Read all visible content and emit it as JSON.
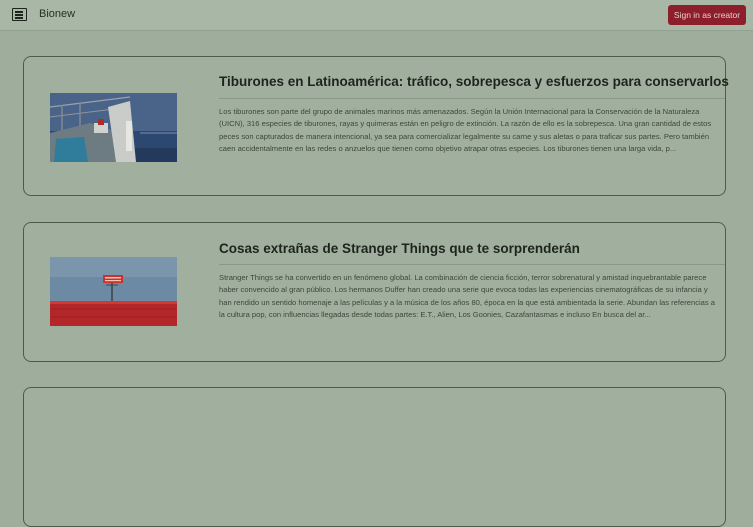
{
  "header": {
    "brand_name": "Bionew",
    "brand_icon": "newspaper-icon",
    "signin_label": "Sign in as creator",
    "signin_color": "#8c1f2b"
  },
  "articles": [
    {
      "title": "Tiburones en Latinoamérica: tráfico, sobrepesca y esfuerzos para conservarlos",
      "excerpt": "Los tiburones son parte del grupo de animales marinos más amenazados. Según la Unión Internacional para la Conservación de la Naturaleza (UICN), 316 especies de tiburones, rayas y quimeras están en peligro de extinción. La razón de ello es la sobrepesca. Una gran cantidad de estos peces son capturados de manera intencional, ya sea para comercializar legalmente su carne y sus aletas o para traficar sus partes. Pero también caen accidentalmente en las redes o anzuelos que tienen como objetivo atrapar otras especies. Los tiburones tienen una larga vida, p...",
      "image": "fishing-boat-photo"
    },
    {
      "title": "Cosas extrañas de Stranger Things que te sorprenderán",
      "excerpt": "Stranger Things se ha convertido en un fenómeno global. La combinación de ciencia ficción, terror sobrenatural y amistad inquebrantable parece haber convencido al gran público. Los hermanos Duffer han creado una serie que evoca todas las experiencias cinematográficas de su infancia y han rendido un sentido homenaje a las películas y a la música de los años 80, época en la que está ambientada la serie. Abundan las referencias a la cultura pop, con influencias llegadas desde todas partes: E.T., Alien, Los Goonies, Cazafantasmas e incluso En busca del ar...",
      "image": "stranger-things-sign-photo"
    }
  ]
}
